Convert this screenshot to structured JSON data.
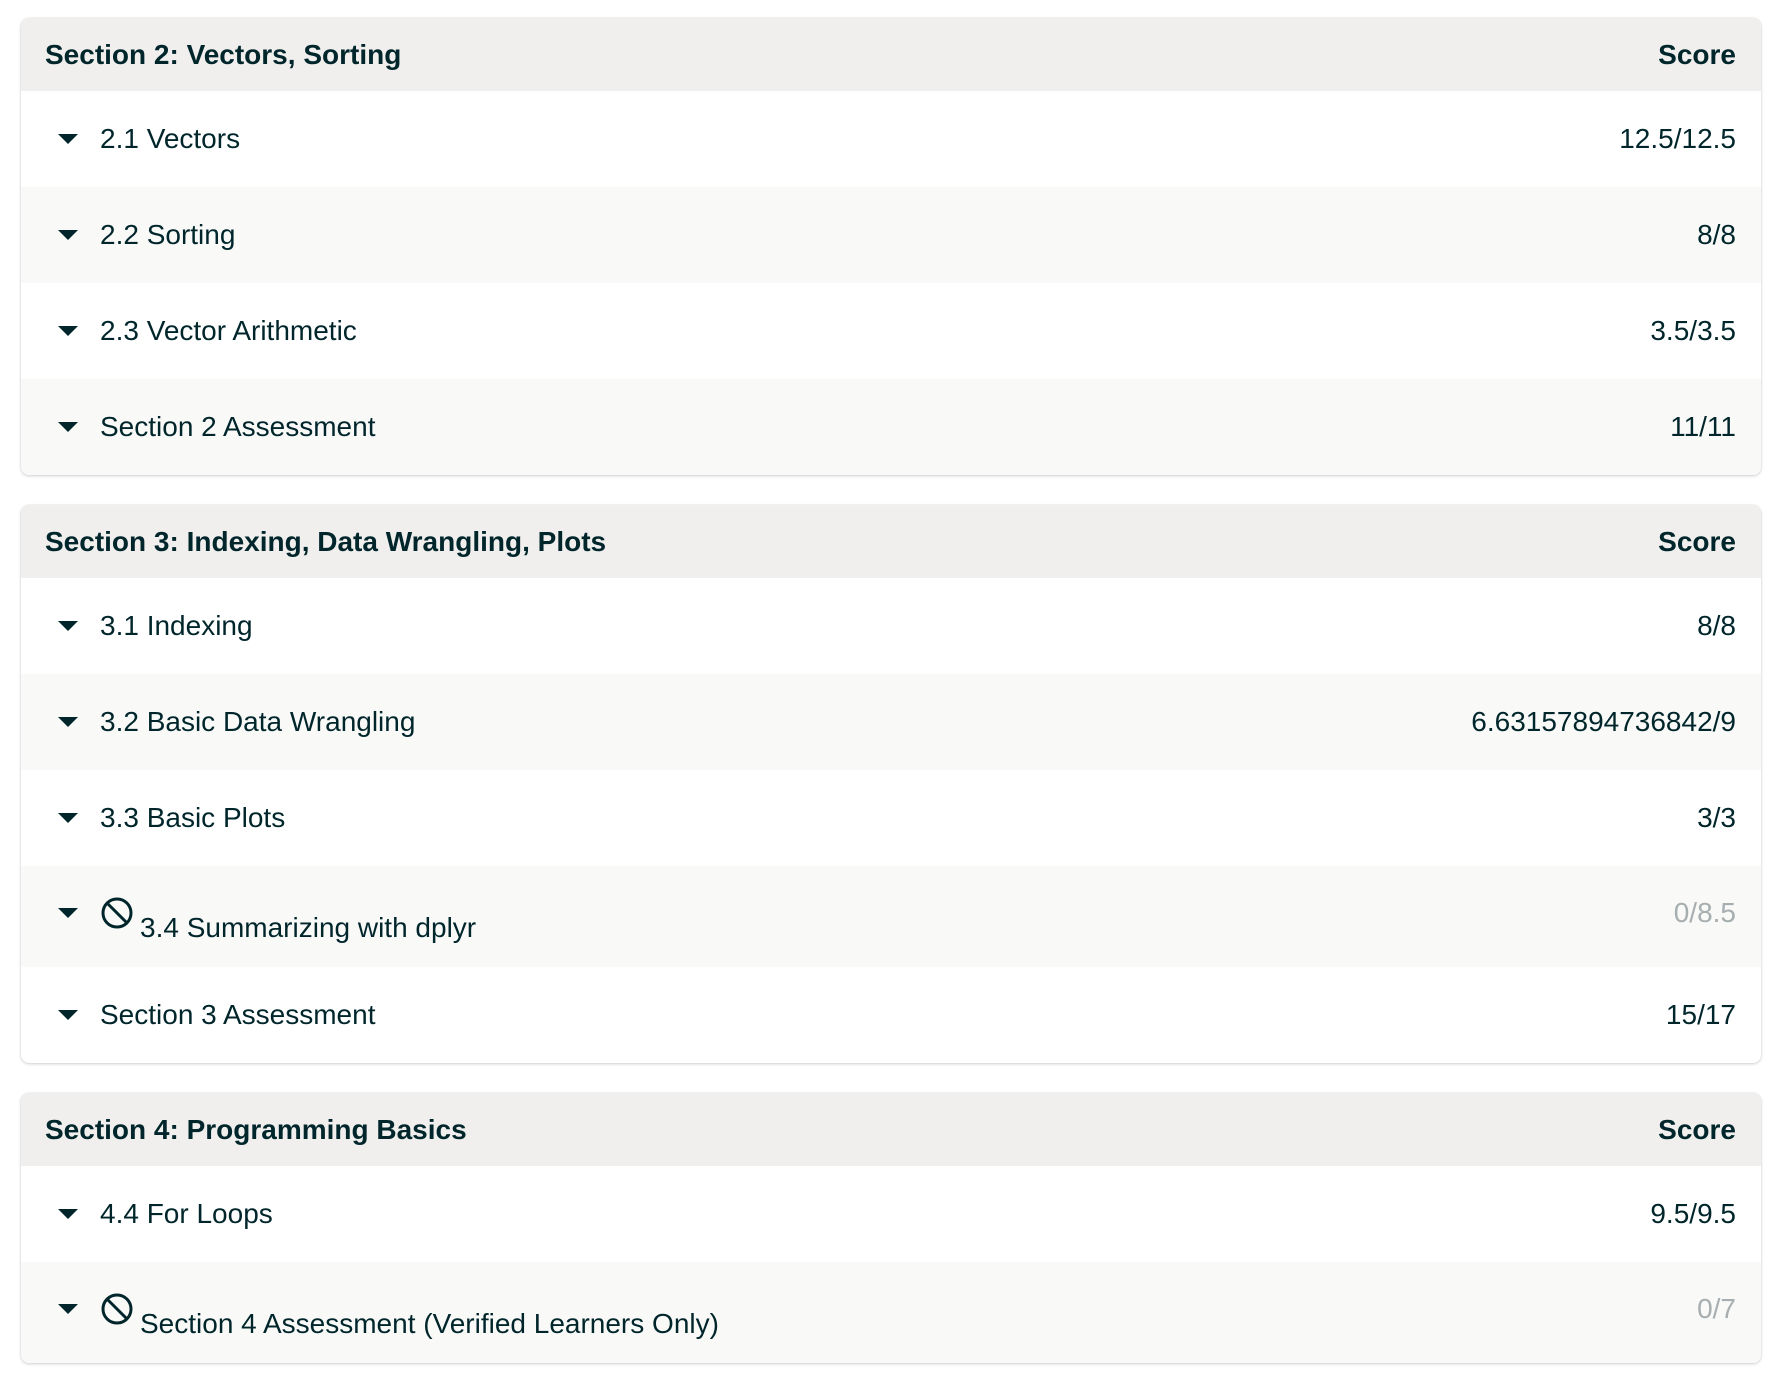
{
  "sections": [
    {
      "title": "Section 2: Vectors, Sorting",
      "score_header": "Score",
      "rows": [
        {
          "label": "2.1 Vectors",
          "score": "12.5/12.5",
          "locked": false
        },
        {
          "label": "2.2 Sorting",
          "score": "8/8",
          "locked": false
        },
        {
          "label": "2.3 Vector Arithmetic",
          "score": "3.5/3.5",
          "locked": false
        },
        {
          "label": "Section 2 Assessment",
          "score": "11/11",
          "locked": false
        }
      ]
    },
    {
      "title": "Section 3: Indexing, Data Wrangling, Plots",
      "score_header": "Score",
      "rows": [
        {
          "label": "3.1 Indexing",
          "score": "8/8",
          "locked": false
        },
        {
          "label": "3.2 Basic Data Wrangling",
          "score": "6.63157894736842/9",
          "locked": false
        },
        {
          "label": "3.3 Basic Plots",
          "score": "3/3",
          "locked": false
        },
        {
          "label": "3.4 Summarizing with dplyr",
          "score": "0/8.5",
          "locked": true,
          "icon": "ban-icon"
        },
        {
          "label": "Section 3 Assessment",
          "score": "15/17",
          "locked": false
        }
      ]
    },
    {
      "title": "Section 4: Programming Basics",
      "score_header": "Score",
      "rows": [
        {
          "label": "4.4 For Loops",
          "score": "9.5/9.5",
          "locked": false
        },
        {
          "label": "Section 4 Assessment (Verified Learners Only)",
          "score": "0/7",
          "locked": true,
          "icon": "ban-icon"
        }
      ]
    }
  ],
  "colors": {
    "text": "#00262b",
    "header_bg": "#f0efee",
    "alt_row_bg": "#f9f9f8",
    "locked_score": "#a6aeb0"
  }
}
